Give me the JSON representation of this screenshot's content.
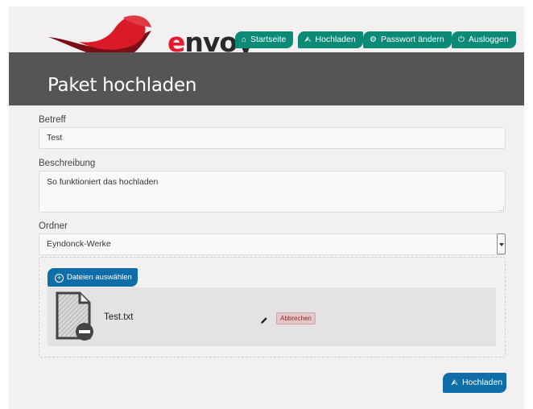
{
  "brand": {
    "logo_first": "e",
    "logo_rest": "nvoy",
    "accent": "#e41a2c"
  },
  "nav": {
    "items": [
      {
        "label": "Startseite",
        "icon": "home-icon"
      },
      {
        "label": "Hochladen",
        "icon": "upload-icon"
      },
      {
        "label": "Passwort ändern",
        "icon": "gear-icon"
      },
      {
        "label": "Ausloggen",
        "icon": "power-icon"
      }
    ],
    "color": "#0b8a76"
  },
  "page": {
    "title": "Paket hochladen"
  },
  "form": {
    "subject": {
      "label": "Betreff",
      "value": "Test"
    },
    "description": {
      "label": "Beschreibung",
      "value": "So funktioniert das hochladen"
    },
    "folder": {
      "label": "Ordner",
      "value": "Eyndonck-Werke"
    }
  },
  "files": {
    "choose_label": "Dateien auswählen",
    "items": [
      {
        "name": "Test.txt",
        "cancel_label": "Abbrechen"
      }
    ]
  },
  "actions": {
    "upload_label": "Hochladen",
    "primary_color": "#0f6ea8"
  }
}
